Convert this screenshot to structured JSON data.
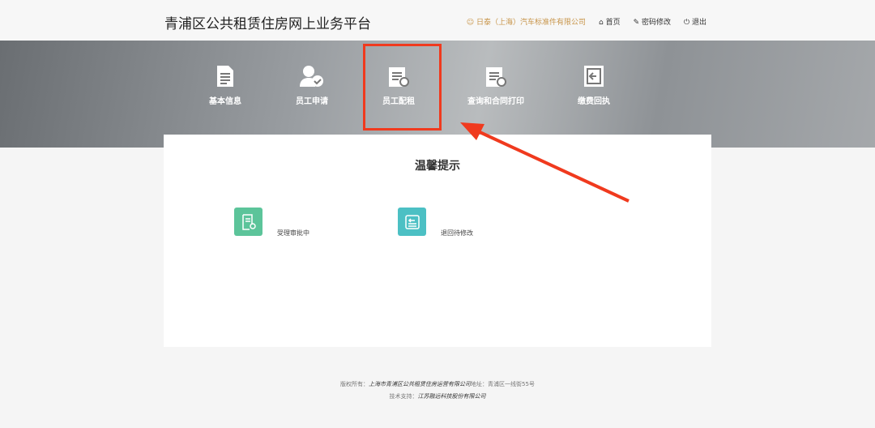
{
  "header": {
    "title": "青浦区公共租赁住房网上业务平台",
    "user": "日泰（上海）汽车标准件有限公司",
    "home": "首页",
    "password": "密码修改",
    "logout": "退出"
  },
  "nav": [
    {
      "label": "基本信息",
      "icon": "document-icon"
    },
    {
      "label": "员工申请",
      "icon": "user-check-icon"
    },
    {
      "label": "员工配租",
      "icon": "notepad-search-icon"
    },
    {
      "label": "查询和合同打印",
      "icon": "notepad-search-icon"
    },
    {
      "label": "缴费回执",
      "icon": "exit-icon"
    }
  ],
  "card": {
    "title": "温馨提示",
    "tiles": [
      {
        "label": "受理审批中",
        "color": "#5cc49a"
      },
      {
        "label": "退回待修改",
        "color": "#4cc0c4"
      }
    ]
  },
  "footer": {
    "copyright_label": "版权所有：",
    "copyright": "上海市青浦区公共租赁住房运营有限公司",
    "address_label": "地址：",
    "address": "青浦区一线街55号",
    "support_label": "技术支持：",
    "support": "江苏融远科技股份有限公司"
  },
  "colors": {
    "highlight": "#f03a1e"
  }
}
